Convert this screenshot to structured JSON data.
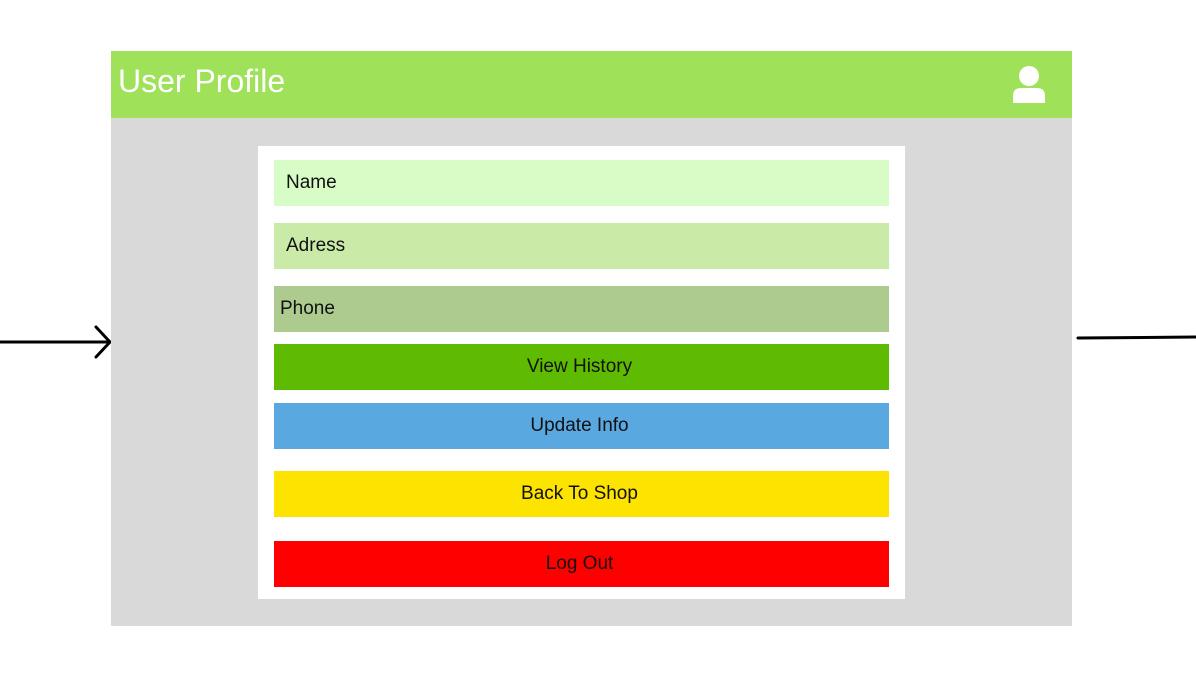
{
  "header": {
    "title": "User Profile",
    "user_icon": "user-icon",
    "background": "#9fe25a"
  },
  "profile": {
    "fields": {
      "name": "Name",
      "address": "Adress",
      "phone": "Phone"
    },
    "buttons": {
      "view_history": "View History",
      "update_info": "Update Info",
      "back_to_shop": "Back To Shop",
      "log_out": "Log Out"
    }
  },
  "colors": {
    "name_field": "#d7fcc5",
    "address_field": "#c9eba7",
    "phone_field": "#adcb8f",
    "view_history": "#5fbb01",
    "update_info": "#5aa8e0",
    "back_to_shop": "#fde300",
    "log_out": "#ff0000"
  },
  "flow": {
    "incoming_arrow_icon": "arrow-right-icon",
    "outgoing_connector": "connector-line"
  }
}
